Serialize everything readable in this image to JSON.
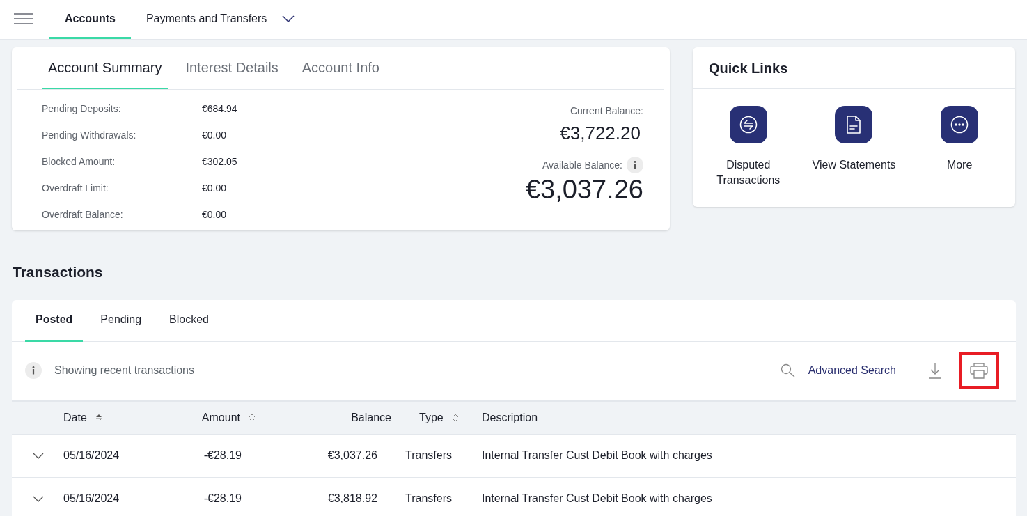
{
  "top_nav": {
    "tabs": [
      {
        "label": "Accounts",
        "selected": true,
        "dropdown": false
      },
      {
        "label": "Payments and Transfers",
        "selected": false,
        "dropdown": true
      }
    ]
  },
  "account_card": {
    "tabs": [
      {
        "label": "Account Summary",
        "selected": true
      },
      {
        "label": "Interest Details",
        "selected": false
      },
      {
        "label": "Account Info",
        "selected": false
      }
    ],
    "details": [
      {
        "label": "Pending Deposits:",
        "value": "€684.94"
      },
      {
        "label": "Pending Withdrawals:",
        "value": "€0.00"
      },
      {
        "label": "Blocked Amount:",
        "value": "€302.05"
      },
      {
        "label": "Overdraft Limit:",
        "value": "€0.00"
      },
      {
        "label": "Overdraft Balance:",
        "value": "€0.00"
      }
    ],
    "current_balance": {
      "label": "Current Balance:",
      "value": "€3,722.20"
    },
    "available_balance": {
      "label": "Available Balance:",
      "value": "€3,037.26"
    }
  },
  "quick_links": {
    "title": "Quick Links",
    "items": [
      {
        "kind": "dispute",
        "label": "Disputed Transactions"
      },
      {
        "kind": "statement",
        "label": "View Statements"
      },
      {
        "kind": "more",
        "label": "More"
      }
    ]
  },
  "transactions": {
    "title": "Transactions",
    "tabs": [
      {
        "label": "Posted",
        "selected": true
      },
      {
        "label": "Pending",
        "selected": false
      },
      {
        "label": "Blocked",
        "selected": false
      }
    ],
    "notice": "Showing recent transactions",
    "advanced_search": "Advanced Search",
    "print_highlighted": true,
    "columns": [
      {
        "label": "Date",
        "sortable": true,
        "sorted": true
      },
      {
        "label": "Amount",
        "sortable": true,
        "sorted": false
      },
      {
        "label": "Balance",
        "sortable": false
      },
      {
        "label": "Type",
        "sortable": true,
        "sorted": false
      },
      {
        "label": "Description",
        "sortable": false
      }
    ],
    "rows": [
      {
        "expanded": false,
        "cells": [
          "05/16/2024",
          "-€28.19",
          "€3,037.26",
          "Transfers",
          "Internal Transfer Cust Debit Book with charges"
        ]
      },
      {
        "expanded": false,
        "cells": [
          "05/16/2024",
          "-€28.19",
          "€3,818.92",
          "Transfers",
          "Internal Transfer Cust Debit Book with charges"
        ]
      }
    ]
  }
}
